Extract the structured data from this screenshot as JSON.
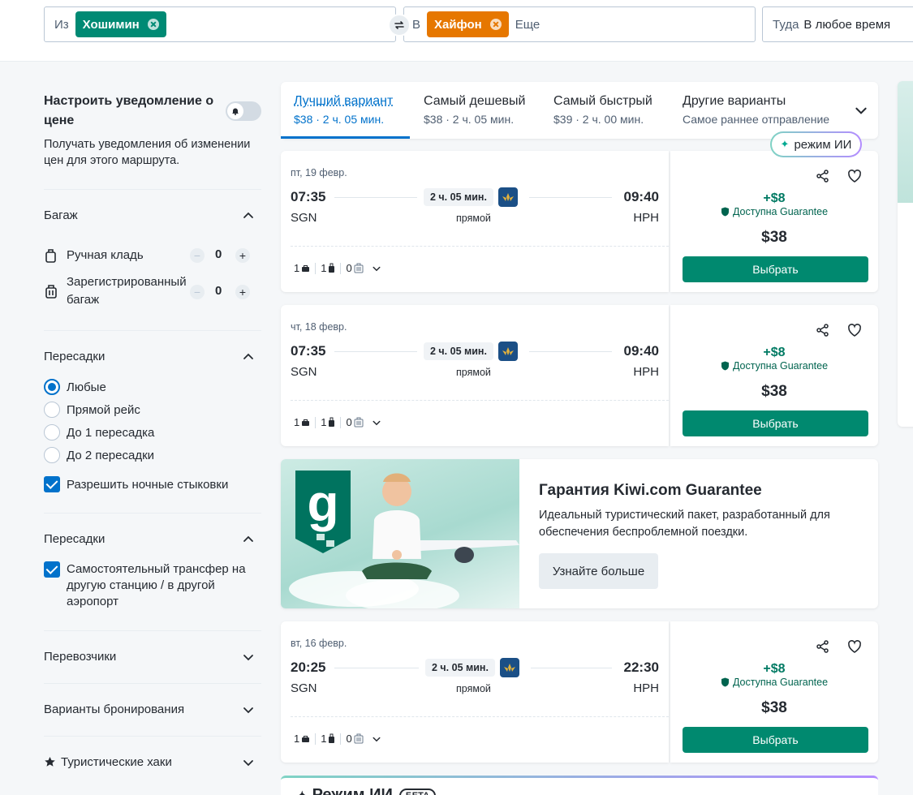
{
  "search": {
    "from_label": "Из",
    "from_city": "Хошимин",
    "to_label": "В",
    "to_city": "Хайфон",
    "more_placeholder": "Еще",
    "when_label": "Туда",
    "when_value": "В любое время"
  },
  "sidebar": {
    "alert_title": "Настроить уведомление о цене",
    "alert_desc": "Получать уведомления об изменении цен для этого маршрута.",
    "baggage": {
      "title": "Багаж",
      "cabin_label": "Ручная кладь",
      "cabin_value": "0",
      "checked_label": "Зарегистрированный багаж",
      "checked_value": "0"
    },
    "stops": {
      "title": "Пересадки",
      "options": [
        "Любые",
        "Прямой рейс",
        "До 1 пересадка",
        "До 2 пересадки"
      ],
      "selected": "Любые",
      "overnight_label": "Разрешить ночные стыковки"
    },
    "transfers": {
      "title": "Пересадки",
      "self_transfer_label": "Самостоятельный трансфер на другую станцию / в другой аэропорт"
    },
    "carriers_title": "Перевозчики",
    "booking_title": "Варианты бронирования",
    "hacks_title": "Туристические хаки"
  },
  "tabs": [
    {
      "title": "Лучший вариант",
      "sub": "$38 · 2 ч. 05 мин."
    },
    {
      "title": "Самый дешевый",
      "sub": "$38 · 2 ч. 05 мин."
    },
    {
      "title": "Самый быстрый",
      "sub": "$39 · 2 ч. 00 мин."
    },
    {
      "title": "Другие варианты",
      "sub": "Самое раннее отправление"
    }
  ],
  "ai_mode_label": "режим ИИ",
  "flights": [
    {
      "date": "пт, 19 февр.",
      "dep": "07:35",
      "arr": "09:40",
      "from": "SGN",
      "to": "HPH",
      "duration": "2 ч. 05 мин.",
      "stops": "прямой",
      "bags": [
        "1",
        "1",
        "0"
      ],
      "price_diff": "+$8",
      "guarantee": "Доступна Guarantee",
      "price": "$38",
      "select": "Выбрать"
    },
    {
      "date": "чт, 18 февр.",
      "dep": "07:35",
      "arr": "09:40",
      "from": "SGN",
      "to": "HPH",
      "duration": "2 ч. 05 мин.",
      "stops": "прямой",
      "bags": [
        "1",
        "1",
        "0"
      ],
      "price_diff": "+$8",
      "guarantee": "Доступна Guarantee",
      "price": "$38",
      "select": "Выбрать"
    },
    {
      "date": "вт, 16 февр.",
      "dep": "20:25",
      "arr": "22:30",
      "from": "SGN",
      "to": "HPH",
      "duration": "2 ч. 05 мин.",
      "stops": "прямой",
      "bags": [
        "1",
        "1",
        "0"
      ],
      "price_diff": "+$8",
      "guarantee": "Доступна Guarantee",
      "price": "$38",
      "select": "Выбрать"
    }
  ],
  "promo": {
    "title": "Гарантия Kiwi.com Guarantee",
    "desc": "Идеальный туристический пакет, разработанный для обеспечения беспроблемной поездки.",
    "button": "Узнайте больше"
  },
  "ai_panel": {
    "title": "Режим ИИ",
    "badge": "БЕТА"
  },
  "colors": {
    "accent_blue": "#0172cb",
    "select_green": "#00896f",
    "chip_from": "#008a74",
    "chip_to": "#e67700"
  }
}
